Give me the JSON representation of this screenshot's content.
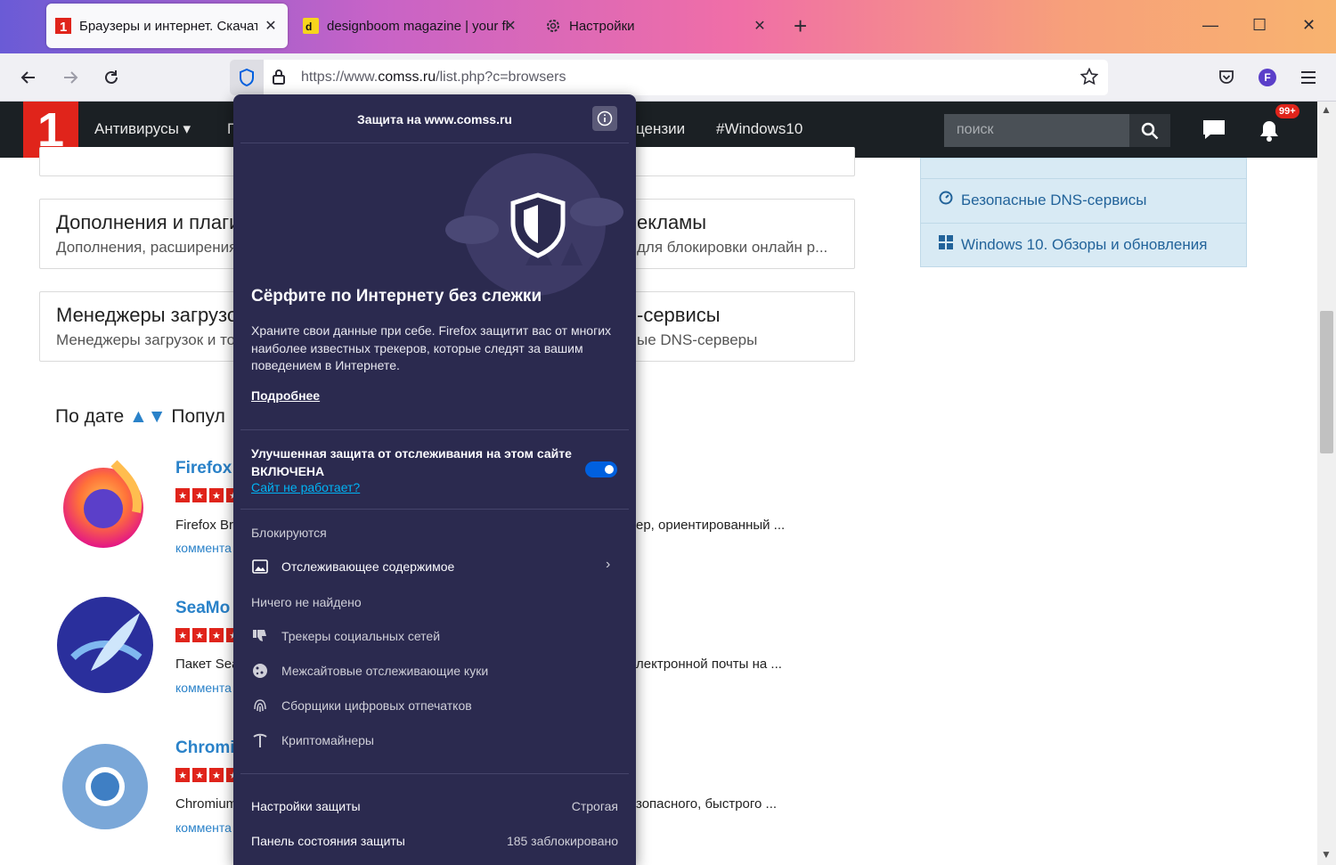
{
  "browser": {
    "tabs": [
      {
        "title": "Браузеры и интернет. Скачать",
        "active": true,
        "icon": "comss-favicon"
      },
      {
        "title": "designboom magazine | your fi",
        "active": false,
        "icon": "designboom-favicon"
      },
      {
        "title": "Настройки",
        "active": false,
        "icon": "gear-icon"
      }
    ],
    "url_prefix": "https://www.",
    "url_domain": "comss.ru",
    "url_path": "/list.php?c=browsers",
    "account_initial": "F"
  },
  "site": {
    "logo": "1",
    "menu": [
      "Антивирусы",
      "П",
      "цензии",
      "#Windows10"
    ],
    "search_placeholder": "поиск",
    "notif_badge": "99+",
    "cards": [
      {
        "title": "Дополнения и плаги",
        "sub": "Дополнения, расширения"
      },
      {
        "title": "екламы",
        "sub": "для блокировки онлайн р..."
      },
      {
        "title": "Менеджеры загрузо",
        "sub": "Менеджеры загрузок и то"
      },
      {
        "title": "-сервисы",
        "sub": "ые DNS-серверы"
      }
    ],
    "sidebar": [
      {
        "label": "Безопасные DNS-сервисы"
      },
      {
        "label": "Windows 10. Обзоры и обновления"
      }
    ],
    "sort": {
      "by_date": "По дате",
      "arrows": "▲▼",
      "popular": "Попул"
    },
    "apps": [
      {
        "name": "Firefox",
        "desc": "Firefox Br",
        "comm": "коммента",
        "desc_right": "ер, ориентированный ..."
      },
      {
        "name": "SeaMo",
        "desc": "Пакет Sea",
        "comm": "коммента",
        "desc_right": "лектронной почты на ..."
      },
      {
        "name": "Chromi",
        "desc": "Chromium",
        "comm": "коммента",
        "desc_right": "зопасного, быстрого ..."
      }
    ]
  },
  "panel": {
    "title": "Защита на www.comss.ru",
    "headline": "Сёрфите по Интернету без слежки",
    "text": "Храните свои данные при себе. Firefox защитит вас от многих наиболее известных трекеров, которые следят за вашим поведением в Интернете.",
    "learn_more": "Подробнее",
    "etp_status": "Улучшенная защита от отслеживания на этом сайте ВКЛЮЧЕНА",
    "etp_enabled": true,
    "site_broken": "Сайт не работает?",
    "blocked_label": "Блокируются",
    "blocked_items": [
      "Отслеживающее содержимое"
    ],
    "not_found_label": "Ничего не найдено",
    "not_found_items": [
      "Трекеры социальных сетей",
      "Межсайтовые отслеживающие куки",
      "Сборщики цифровых отпечатков",
      "Криптомайнеры"
    ],
    "settings_label": "Настройки защиты",
    "settings_value": "Строгая",
    "dashboard_label": "Панель состояния защиты",
    "dashboard_value": "185 заблокировано"
  }
}
